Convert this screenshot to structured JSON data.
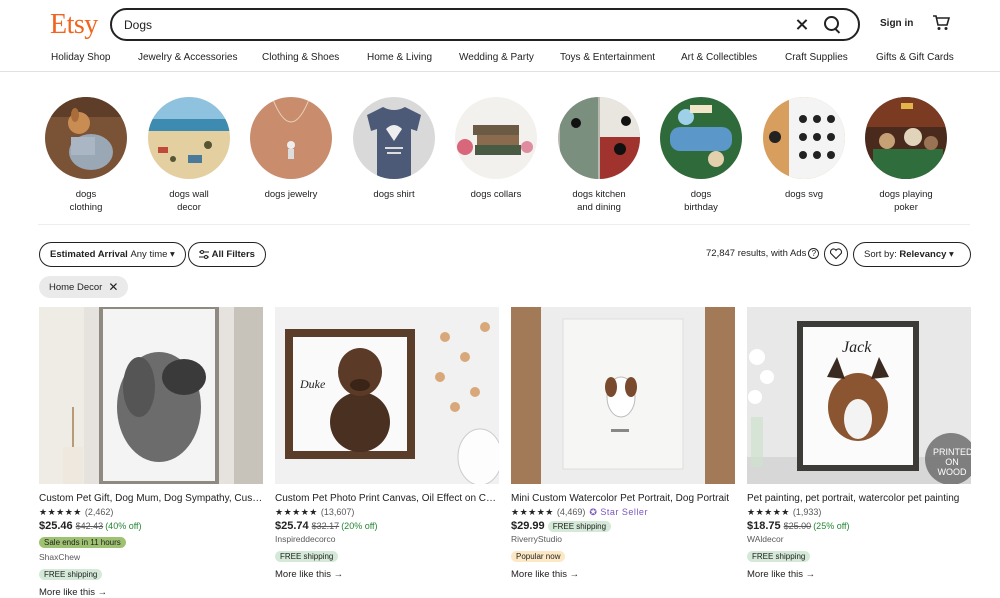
{
  "header": {
    "logo": "Etsy",
    "search_value": "Dogs",
    "signin": "Sign in"
  },
  "categories": [
    "Holiday Shop",
    "Jewelry & Accessories",
    "Clothing & Shoes",
    "Home & Living",
    "Wedding & Party",
    "Toys & Entertainment",
    "Art & Collectibles",
    "Craft Supplies",
    "Gifts & Gift Cards"
  ],
  "related": [
    {
      "l1": "dogs",
      "l2": "clothing"
    },
    {
      "l1": "dogs wall",
      "l2": "decor"
    },
    {
      "l1": "dogs jewelry",
      "l2": ""
    },
    {
      "l1": "dogs shirt",
      "l2": ""
    },
    {
      "l1": "dogs collars",
      "l2": ""
    },
    {
      "l1": "dogs kitchen",
      "l2": "and dining"
    },
    {
      "l1": "dogs",
      "l2": "birthday"
    },
    {
      "l1": "dogs svg",
      "l2": ""
    },
    {
      "l1": "dogs playing",
      "l2": "poker"
    }
  ],
  "filters": {
    "arrival_label": "Estimated Arrival",
    "arrival_value": "Any time",
    "all_filters": "All Filters",
    "results": "72,847 results, with Ads",
    "sort_label": "Sort by:",
    "sort_value": "Relevancy",
    "active_chip": "Home Decor"
  },
  "products": [
    {
      "title": "Custom Pet Gift, Dog Mum, Dog Sympathy, Custom Pet Portrait",
      "stars": "★★★★★",
      "reviews": "(2,462)",
      "price": "$25.46",
      "orig": "$42.43",
      "disc": "(40% off)",
      "sale": "Sale ends in 11 hours",
      "shop": "ShaxChew",
      "shipping": "FREE shipping",
      "more": "More like this"
    },
    {
      "title": "Custom Pet Photo Print Canvas, Oil Effect on Canvas",
      "stars": "★★★★★",
      "reviews": "(13,607)",
      "price": "$25.74",
      "orig": "$32.17",
      "disc": "(20% off)",
      "shop": "Inspireddecorco",
      "shipping": "FREE shipping",
      "more": "More like this"
    },
    {
      "title": "Mini Custom Watercolor Pet Portrait, Dog Portrait",
      "stars": "★★★★★",
      "reviews": "(4,469)",
      "star_seller": "Star Seller",
      "price": "$29.99",
      "shipping": "FREE shipping",
      "shop": "RiverryStudio",
      "popular": "Popular now",
      "more": "More like this"
    },
    {
      "title": "Pet painting, pet portrait, watercolor pet painting",
      "stars": "★★★★★",
      "reviews": "(1,933)",
      "price": "$18.75",
      "orig": "$25.00",
      "disc": "(25% off)",
      "shop": "WAldecor",
      "shipping": "FREE shipping",
      "more": "More like this",
      "overlay": "PRINTED ON WOOD",
      "overlay_name": "Jack"
    }
  ],
  "photo_texts": {
    "duke": "Duke"
  }
}
